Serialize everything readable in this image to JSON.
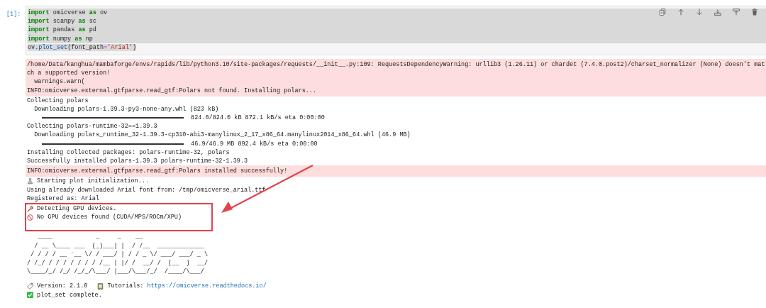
{
  "cell": {
    "prompt": "[1]:",
    "toolbar": [
      {
        "kind": "duplicate"
      },
      {
        "kind": "move-up"
      },
      {
        "kind": "move-down"
      },
      {
        "kind": "insert-below"
      },
      {
        "kind": "insert-above"
      },
      {
        "kind": "delete"
      }
    ],
    "code": [
      {
        "selected": true,
        "tokens": [
          {
            "t": "import",
            "kind": "keyword"
          },
          {
            "t": " omicverse ",
            "kind": "plain"
          },
          {
            "t": "as",
            "kind": "keyword"
          },
          {
            "t": " ov",
            "kind": "plain"
          }
        ]
      },
      {
        "selected": true,
        "tokens": [
          {
            "t": "import",
            "kind": "keyword"
          },
          {
            "t": " scanpy ",
            "kind": "plain"
          },
          {
            "t": "as",
            "kind": "keyword"
          },
          {
            "t": " sc",
            "kind": "plain"
          }
        ]
      },
      {
        "selected": true,
        "tokens": [
          {
            "t": "import",
            "kind": "keyword"
          },
          {
            "t": " pandas ",
            "kind": "plain"
          },
          {
            "t": "as",
            "kind": "keyword"
          },
          {
            "t": " pd",
            "kind": "plain"
          }
        ]
      },
      {
        "selected": true,
        "tokens": [
          {
            "t": "import",
            "kind": "keyword"
          },
          {
            "t": " numpy ",
            "kind": "plain"
          },
          {
            "t": "as",
            "kind": "keyword"
          },
          {
            "t": " np",
            "kind": "plain"
          }
        ]
      },
      {
        "selected": true,
        "tokens": [
          {
            "t": "ov.",
            "kind": "plain"
          },
          {
            "t": "plot_set",
            "kind": "call"
          },
          {
            "t": "(font_path",
            "kind": "plain"
          },
          {
            "t": "=",
            "kind": "operator"
          },
          {
            "t": "'Arial'",
            "kind": "string"
          },
          {
            "t": ")",
            "kind": "plain"
          }
        ]
      }
    ],
    "outputs": [
      {
        "error": true,
        "lines": [
          {
            "kind": "text",
            "text": "/home/Data/kanghua/mambaforge/envs/rapids/lib/python3.10/site-packages/requests/__init__.py:109: RequestsDependencyWarning: urllib3 (1.26.11) or chardet (7.4.0.post2)/charset_normalizer (None) doesn't mat"
          },
          {
            "kind": "text",
            "text": "ch a supported version!"
          },
          {
            "kind": "text",
            "text": "  warnings.warn("
          },
          {
            "kind": "text",
            "text": "INFO:omicverse.external.gtfparse.read_gtf:Polars not found. Installing polars..."
          }
        ]
      },
      {
        "error": false,
        "lines": [
          {
            "kind": "text",
            "text": "Collecting polars"
          },
          {
            "kind": "text",
            "text": "  Downloading polars-1.39.3-py3-none-any.whl (823 kB)"
          },
          {
            "kind": "progress",
            "level": 1,
            "text": "824.0/824.0 kB 872.1 kB/s eta 0:00:00"
          },
          {
            "kind": "text",
            "text": "Collecting polars-runtime-32==1.39.3"
          },
          {
            "kind": "text",
            "text": "  Downloading polars_runtime_32-1.39.3-cp310-abi3-manylinux_2_17_x86_64.manylinux2014_x86_64.whl (46.9 MB)"
          },
          {
            "kind": "progress",
            "level": 1,
            "text": "46.9/46.9 MB 892.4 kB/s eta 0:00:00"
          },
          {
            "kind": "text",
            "text": "Installing collected packages: polars-runtime-32, polars"
          },
          {
            "kind": "text",
            "text": "Successfully installed polars-1.39.3 polars-runtime-32-1.39.3"
          }
        ]
      },
      {
        "error": true,
        "lines": [
          {
            "kind": "text",
            "text": "INFO:omicverse.external.gtfparse.read_gtf:Polars installed successfully!"
          }
        ]
      },
      {
        "error": false,
        "lines": [
          {
            "kind": "parts",
            "highlighted": false,
            "parts": [
              {
                "kind": "flask"
              },
              {
                "kind": "text",
                "text": "Starting plot initialization..."
              }
            ]
          },
          {
            "kind": "text",
            "text": "Using already downloaded Arial font from: /tmp/omicverse_arial.ttf"
          },
          {
            "kind": "text",
            "text": "Registered as: Arial"
          },
          {
            "kind": "parts",
            "highlighted": true,
            "parts": [
              {
                "kind": "wrench"
              },
              {
                "kind": "text",
                "text": "Detecting GPU devices…"
              }
            ]
          },
          {
            "kind": "parts",
            "highlighted": true,
            "parts": [
              {
                "kind": "blocked"
              },
              {
                "kind": "text",
                "text": "No GPU devices found (CUDA/MPS/ROCm/XPU)"
              }
            ]
          },
          {
            "kind": "banner",
            "lines": [
              "   ____            _     _    __",
              "  / __ \\____ ___  (_)___| |  / /__  _____________",
              " / / / / __ `__ \\/ / ___/ | / / _ \\/ ___/ ___/ _ \\",
              "/ /_/ / / / / / / / /__ | |/ /  __/ /  (__  )  __/",
              "\\____/_/ /_/ /_/_/\\___/ |___/\\___/_/  /____/\\___/"
            ]
          },
          {
            "kind": "parts",
            "highlighted": false,
            "parts": [
              {
                "kind": "tag"
              },
              {
                "kind": "text",
                "text": "Version: 2.1.0"
              },
              {
                "kind": "book"
              },
              {
                "kind": "text",
                "text": "Tutorials:"
              },
              {
                "kind": "link",
                "text": "https://omicverse.readthedocs.io/"
              }
            ]
          },
          {
            "kind": "parts",
            "highlighted": false,
            "parts": [
              {
                "kind": "check"
              },
              {
                "kind": "text",
                "text": "plot_set complete."
              }
            ]
          }
        ]
      }
    ]
  }
}
